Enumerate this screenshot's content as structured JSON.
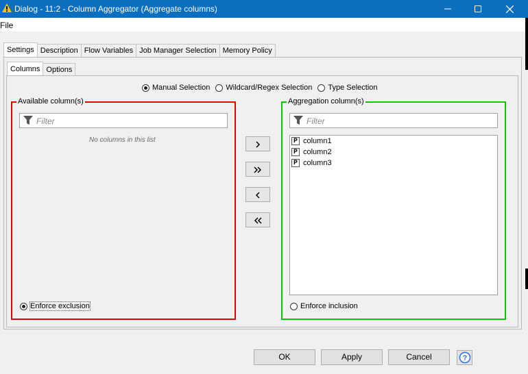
{
  "window": {
    "title": "Dialog - 11:2 - Column Aggregator (Aggregate columns)",
    "colors": {
      "titlebar": "#0c6ebf",
      "available_border": "#e00000",
      "aggregation_border": "#00cc00"
    }
  },
  "menu": {
    "file": "File"
  },
  "tabs": [
    "Settings",
    "Description",
    "Flow Variables",
    "Job Manager Selection",
    "Memory Policy"
  ],
  "subtabs": [
    "Columns",
    "Options"
  ],
  "selection_modes": {
    "options": [
      "Manual Selection",
      "Wildcard/Regex Selection",
      "Type Selection"
    ],
    "selected": "Manual Selection"
  },
  "available": {
    "legend": "Available column(s)",
    "filter_placeholder": "Filter",
    "empty_text": "No columns in this list",
    "enforce_label": "Enforce exclusion",
    "enforce_selected": true
  },
  "aggregation": {
    "legend": "Aggregation column(s)",
    "filter_placeholder": "Filter",
    "columns": [
      {
        "type": "P",
        "name": "column1"
      },
      {
        "type": "P",
        "name": "column2"
      },
      {
        "type": "P",
        "name": "column3"
      }
    ],
    "enforce_label": "Enforce inclusion",
    "enforce_selected": false
  },
  "move_buttons": {
    "add": "›",
    "add_all": "»",
    "remove": "‹",
    "remove_all": "«"
  },
  "buttons": {
    "ok": "OK",
    "apply": "Apply",
    "cancel": "Cancel",
    "help": "?"
  }
}
